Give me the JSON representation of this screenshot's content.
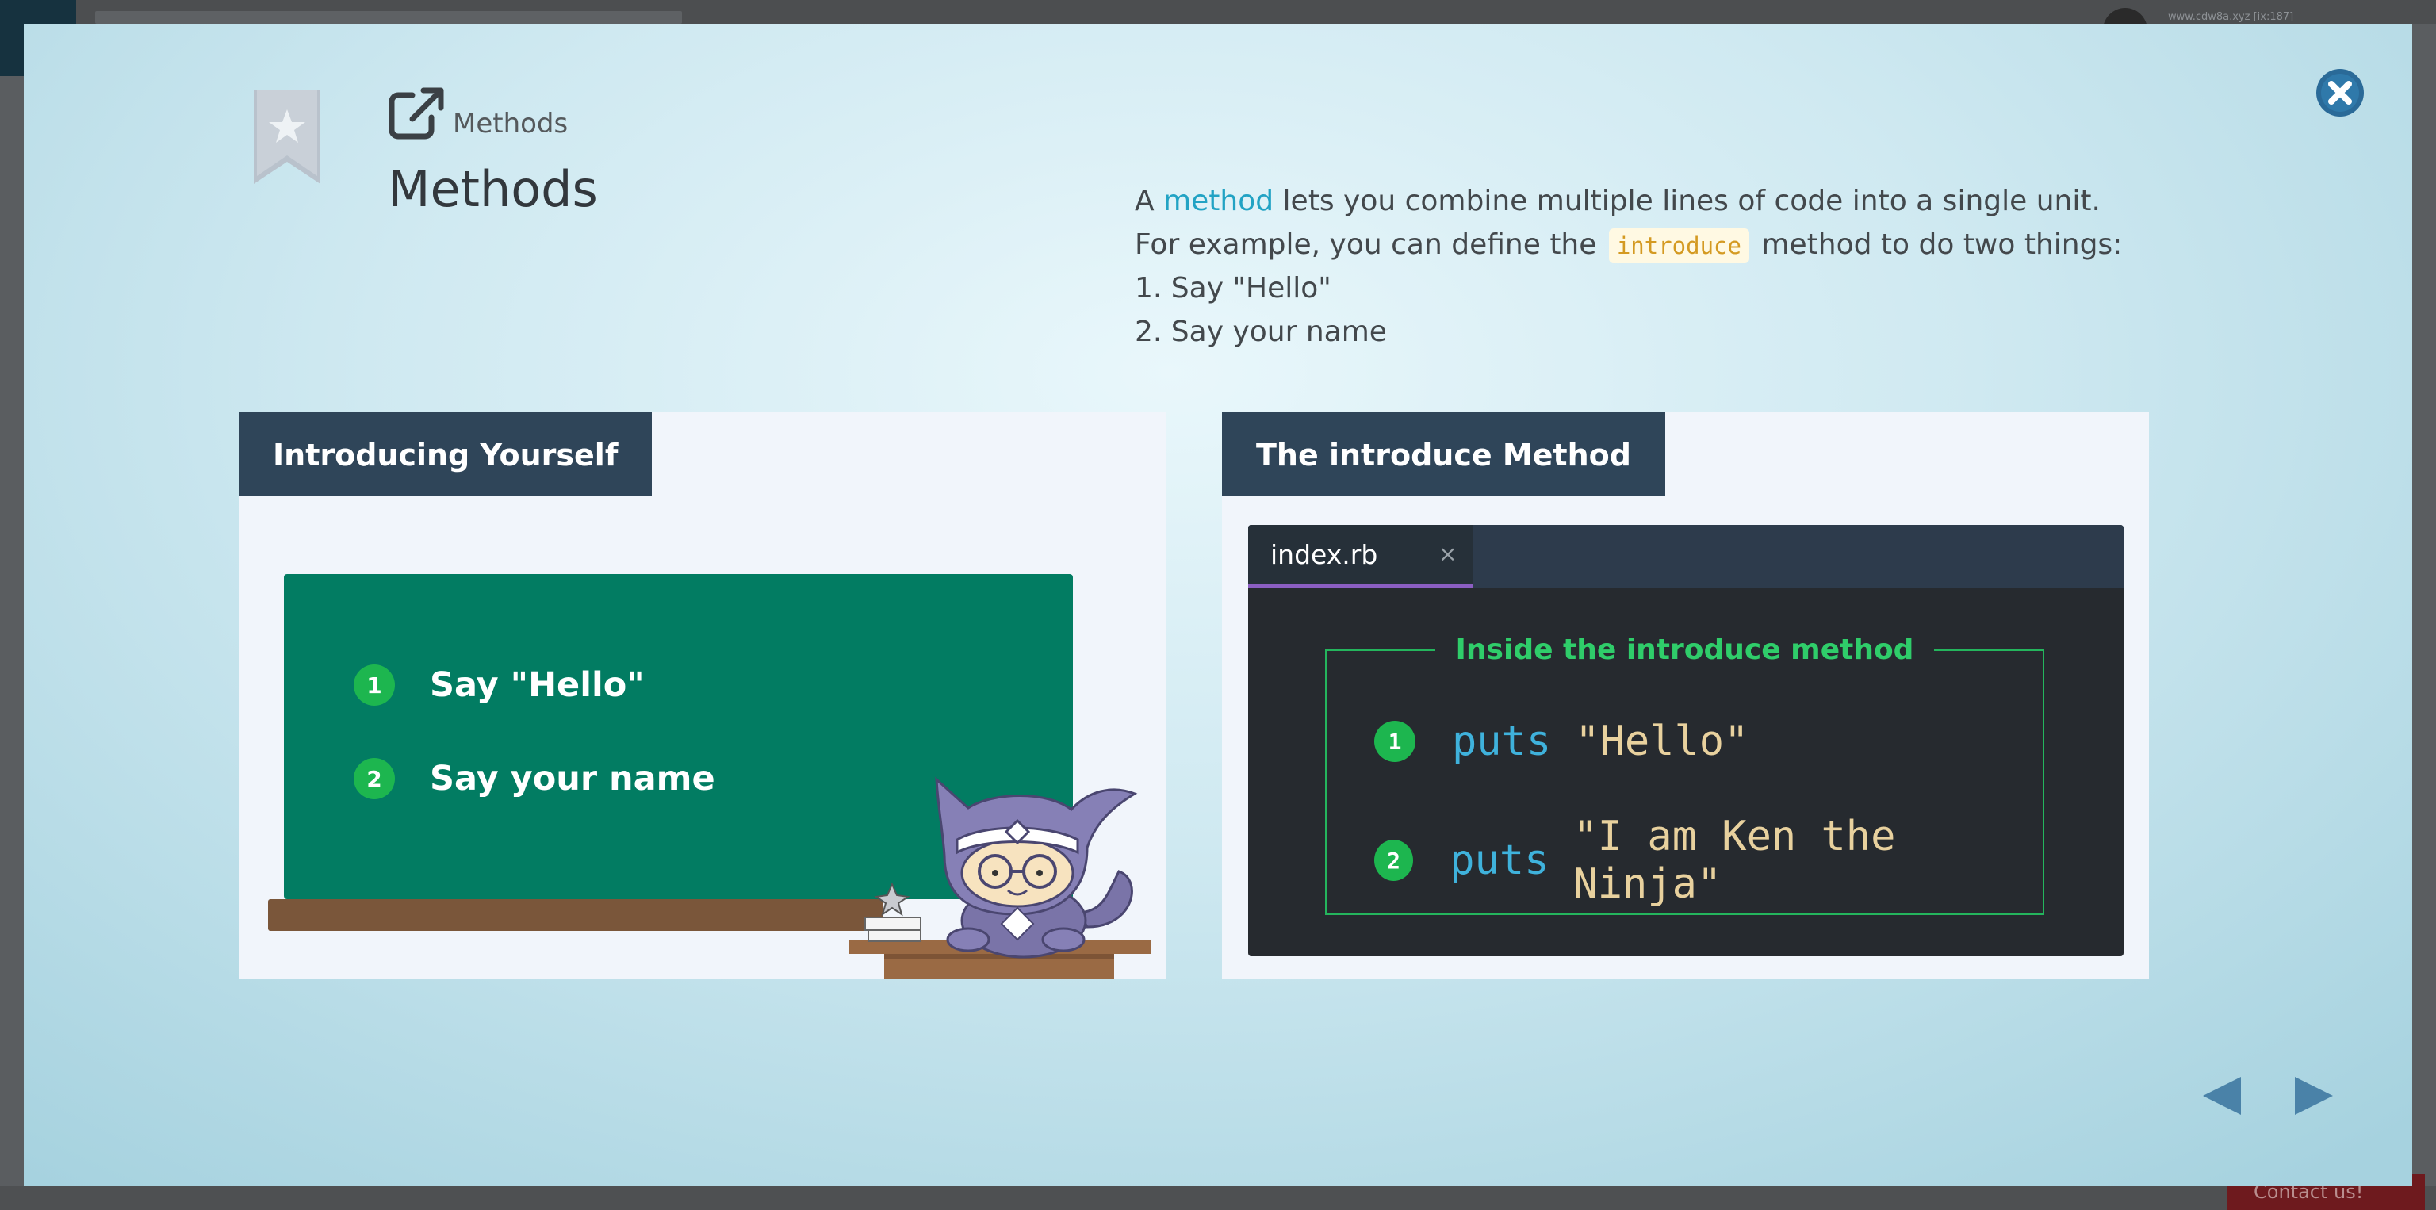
{
  "background": {
    "url_text": "www.cdw8a.xyz [ix:187]",
    "contact_label": "Contact us!"
  },
  "header": {
    "breadcrumb": "Methods",
    "title": "Methods"
  },
  "description": {
    "line1_prefix": "A ",
    "line1_link": "method",
    "line1_suffix": " lets you combine multiple lines of code into a single unit.",
    "line2_prefix": "For example, you can define the ",
    "line2_code": "introduce",
    "line2_suffix": " method to do two things:",
    "step1": "1. Say \"Hello\"",
    "step2": "2. Say your name"
  },
  "left_panel": {
    "heading": "Introducing Yourself",
    "items": [
      {
        "num": "1",
        "text": "Say \"Hello\""
      },
      {
        "num": "2",
        "text": "Say your name"
      }
    ]
  },
  "right_panel": {
    "heading": "The introduce Method",
    "tab_name": "index.rb",
    "tab_close": "×",
    "box_title": "Inside the introduce method",
    "lines": [
      {
        "num": "1",
        "keyword": "puts",
        "string": "\"Hello\""
      },
      {
        "num": "2",
        "keyword": "puts",
        "string": "\"I am Ken the Ninja\""
      }
    ]
  },
  "colors": {
    "accent": "#22a3c4",
    "panel_header": "#2f4559",
    "board": "#027c62",
    "green": "#1db64f",
    "nav_arrow": "#4a82a8"
  },
  "icons": [
    "bookmark-star-icon",
    "external-link-icon",
    "close-icon",
    "prev-arrow-icon",
    "next-arrow-icon",
    "ninja-mascot"
  ]
}
